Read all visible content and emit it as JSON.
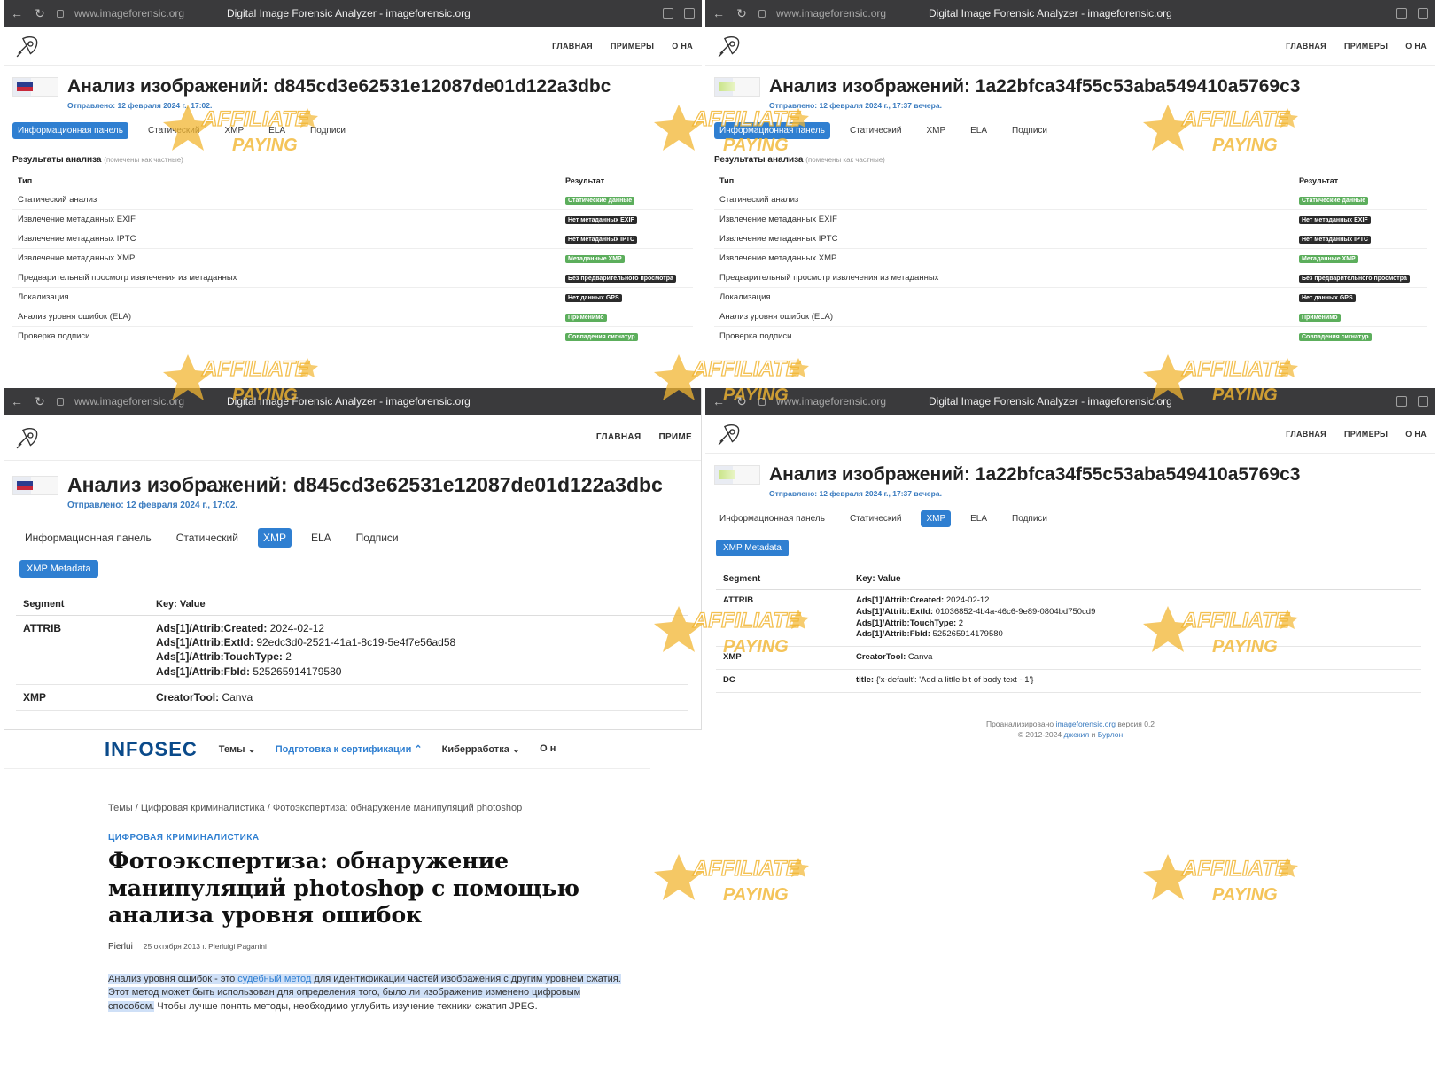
{
  "browser": {
    "url": "www.imageforensic.org",
    "title": "Digital Image Forensic Analyzer - imageforensic.org"
  },
  "nav": {
    "home": "ГЛАВНАЯ",
    "examples": "ПРИМЕРЫ",
    "about": "О НА",
    "examples_cut": "ПРИМЕ"
  },
  "analysis1": {
    "title": "Анализ изображений: d845cd3e62531e12087de01d122a3dbc",
    "sent": "Отправлено: 12 февраля 2024 г., 17:02."
  },
  "analysis2": {
    "title": "Анализ изображений: 1a22bfca34f55c53aba549410a5769c3",
    "sent": "Отправлено: 12 февраля 2024 г., 17:37 вечера."
  },
  "tabs": [
    "Информационная панель",
    "Статический",
    "XMP",
    "ELA",
    "Подписи"
  ],
  "results": {
    "heading": "Результаты анализа",
    "heading_note": "(помечены как частные)",
    "col_type": "Тип",
    "col_result": "Результат",
    "rows": [
      {
        "type": "Статический анализ",
        "result": "Статические данные",
        "ok": true
      },
      {
        "type": "Извлечение метаданных EXIF",
        "result": "Нет метаданных EXIF",
        "ok": false
      },
      {
        "type": "Извлечение метаданных IPTC",
        "result": "Нет метаданных IPTC",
        "ok": false
      },
      {
        "type": "Извлечение метаданных XMP",
        "result": "Метаданные XMP",
        "ok": true
      },
      {
        "type": "Предварительный просмотр извлечения из метаданных",
        "result": "Без предварительного просмотра",
        "ok": false
      },
      {
        "type": "Локализация",
        "result": "Нет данных GPS",
        "ok": false
      },
      {
        "type": "Анализ уровня ошибок (ELA)",
        "result": "Применимо",
        "ok": true
      },
      {
        "type": "Проверка подписи",
        "result": "Совпадения сигнатур",
        "ok": true
      }
    ]
  },
  "xmp": {
    "button": "XMP Metadata",
    "col_segment": "Segment",
    "col_kv": "Key: Value",
    "seg_attrib": "ATTRIB",
    "seg_xmp": "XMP",
    "seg_dc": "DC",
    "k_created": "Ads[1]/Attrib:Created:",
    "k_extid": "Ads[1]/Attrib:ExtId:",
    "k_touch": "Ads[1]/Attrib:TouchType:",
    "k_fbid": "Ads[1]/Attrib:FbId:",
    "k_creator": "CreatorTool:",
    "k_title": "title:",
    "a": {
      "created": " 2024-02-12",
      "extid": " 92edc3d0-2521-41a1-8c19-5e4f7e56ad58",
      "touch": " 2",
      "fbid": " 525265914179580",
      "creator": " Canva"
    },
    "b": {
      "created": " 2024-02-12",
      "extid": " 01036852-4b4a-46c6-9e89-0804bd750cd9",
      "touch": " 2",
      "fbid": " 525265914179580",
      "creator": " Canva",
      "title": " {'x-default': 'Add a little bit of body text - 1'}"
    }
  },
  "footer": {
    "line1_pre": "Проанализировано",
    "line1_link": "imageforensic.org",
    "line1_post": "версия 0.2",
    "line2_pre": "© 2012-2024",
    "line2_a": "джекил",
    "line2_mid": "и",
    "line2_b": "Бурлон"
  },
  "infosec": {
    "logo": "INFOSEC",
    "menu": [
      "Темы",
      "Подготовка к сертификации",
      "Киберработка",
      "О н"
    ],
    "crumb1": "Темы",
    "crumb2": "Цифровая криминалистика",
    "crumb3": "Фотоэкспертиза: обнаружение манипуляций photoshop",
    "category": "ЦИФРОВАЯ КРИМИНАЛИСТИКА",
    "title": "Фотоэкспертиза: обнаружение манипуляций photoshop с помощью анализа уровня ошибок",
    "avatar": "Pierlui",
    "byline": "25 октября 2013 г. Pierluigi Paganini",
    "body_hl_1": "Анализ уровня ошибок - это",
    "body_link": "судебный метод",
    "body_hl_2": "для идентификации частей изображения с другим уровнем сжатия. Этот метод может быть использован для определения того, было ли изображение изменено цифровым способом.",
    "body_rest": "Чтобы лучше понять методы, необходимо углубить изучение техники сжатия JPEG."
  },
  "watermark": {
    "line1": "AFFILIATE",
    "line2": "PAYING"
  },
  "colors": {
    "accent": "#2f7fd1",
    "ok_badge": "#5cae5c",
    "dark_badge": "#2b2b2b",
    "chrome": "#3a3a3c",
    "watermark": "#f2b632"
  }
}
